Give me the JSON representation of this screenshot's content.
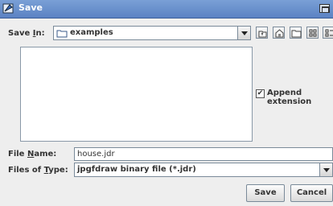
{
  "window": {
    "title": "Save"
  },
  "save_in": {
    "label_pre": "Save ",
    "label_mnemonic": "I",
    "label_post": "n:",
    "value": "examples"
  },
  "toolbar": {
    "icons": [
      "up-folder-icon",
      "home-icon",
      "new-folder-icon",
      "list-view-icon",
      "details-view-icon"
    ]
  },
  "options": {
    "append_extension": "Append extension",
    "append_checked": true
  },
  "file_name": {
    "label_pre": "File ",
    "label_mnemonic": "N",
    "label_post": "ame:",
    "value": "house.jdr"
  },
  "file_type": {
    "label_pre": "Files of ",
    "label_mnemonic": "T",
    "label_post": "ype:",
    "value": "jpgfdraw binary file (*.jdr)"
  },
  "buttons": {
    "save": "Save",
    "cancel": "Cancel"
  }
}
